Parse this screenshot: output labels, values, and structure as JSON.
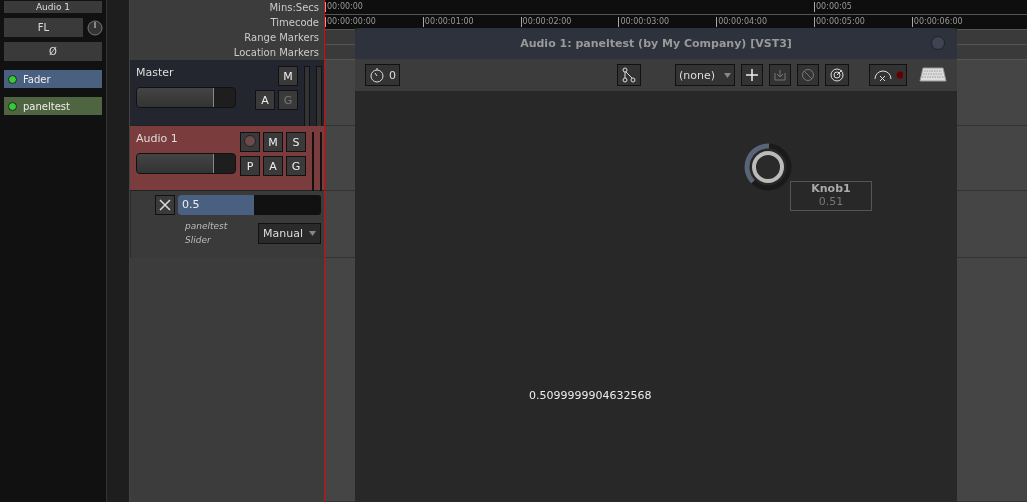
{
  "mixer_strip": {
    "name_button": "Audio 1",
    "input_button": "FL",
    "phase_button": "Ø",
    "processors": [
      {
        "name": "Fader",
        "kind": "fader",
        "on": true
      },
      {
        "name": "paneltest",
        "kind": "plugin",
        "on": true
      }
    ]
  },
  "rulers": [
    {
      "label": "Mins:Secs",
      "kind": "minsec",
      "ticks": [
        "00:00:00",
        "00:00:05"
      ]
    },
    {
      "label": "Timecode",
      "kind": "timecode",
      "ticks": [
        "00:00:00:00",
        "00:00:01:00",
        "00:00:02:00",
        "00:00:03:00",
        "00:00:04:00",
        "00:00:05:00",
        "00:00:06:00"
      ]
    },
    {
      "label": "Range Markers",
      "kind": "markers"
    },
    {
      "label": "Location Markers",
      "kind": "markers"
    }
  ],
  "tracks": [
    {
      "name": "Master",
      "kind": "bus",
      "selected": false,
      "level": 0.78,
      "button_rows": [
        [
          {
            "label": "M",
            "disabled": false
          }
        ],
        [
          {
            "label": "A",
            "disabled": false
          },
          {
            "label": "G",
            "disabled": true
          }
        ]
      ]
    },
    {
      "name": "Audio 1",
      "kind": "audio",
      "selected": true,
      "level": 0.78,
      "button_rows": [
        [
          {
            "label": "M",
            "disabled": false
          },
          {
            "label": "S",
            "disabled": false
          }
        ],
        [
          {
            "label": "P",
            "disabled": false
          },
          {
            "label": "A",
            "disabled": false
          },
          {
            "label": "G",
            "disabled": false
          }
        ]
      ]
    }
  ],
  "automation": {
    "value": "0.5",
    "level": 0.53,
    "plugin": "paneltest",
    "parameter": "Slider",
    "mode": "Manual"
  },
  "plugin_window": {
    "title": "Audio 1: paneltest (by My Company) [VST3]",
    "latency": "0",
    "preset": "(none)",
    "knob": {
      "label": "Knob1",
      "value": "0.51",
      "level": 0.51
    },
    "readout": "0.5099999904632568"
  }
}
